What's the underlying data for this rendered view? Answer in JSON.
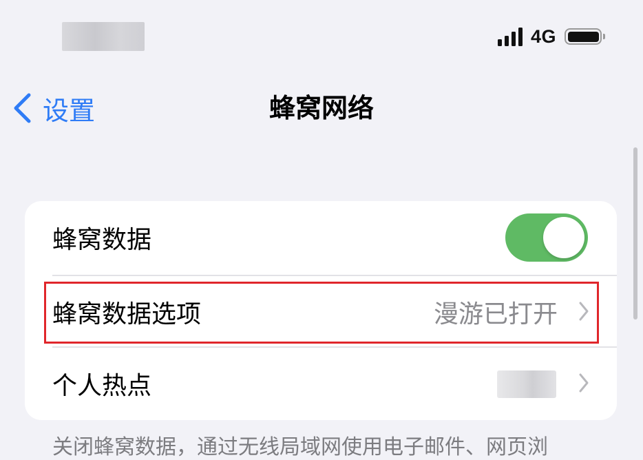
{
  "status_bar": {
    "network": "4G",
    "signal_bars": 4,
    "battery_level": 1.0
  },
  "nav": {
    "back_label": "设置",
    "title": "蜂窝网络"
  },
  "rows": [
    {
      "label": "蜂窝数据",
      "toggle_on": true
    },
    {
      "label": "蜂窝数据选项",
      "value": "漫游已打开"
    },
    {
      "label": "个人热点"
    }
  ],
  "footer_note": "关闭蜂窝数据，通过无线局域网使用电子邮件、网页浏",
  "colors": {
    "accent": "#2f7cf6",
    "toggle_on": "#5fba64",
    "highlight": "#e0262b",
    "background": "#f2f2f7"
  },
  "icons": [
    "signal-icon",
    "battery-icon",
    "back-chevron-icon",
    "chevron-right-icon"
  ]
}
